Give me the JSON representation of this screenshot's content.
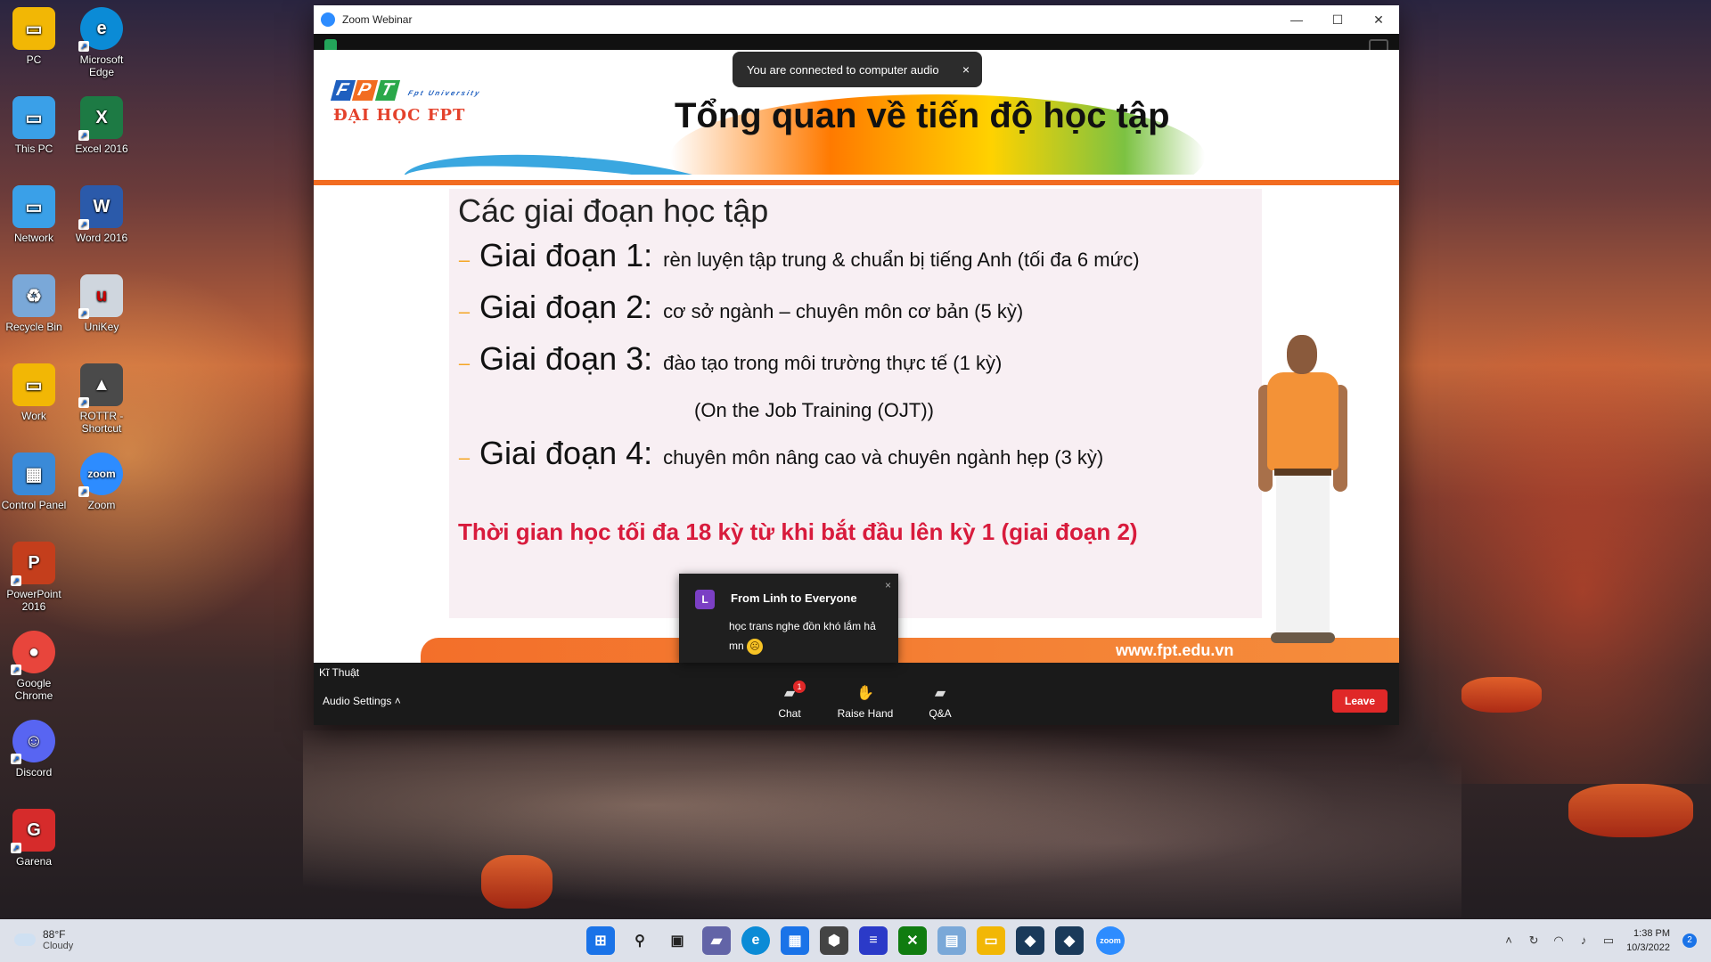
{
  "desktop": {
    "icons": [
      {
        "label": "PC",
        "color": "#f2b705"
      },
      {
        "label": "Microsoft Edge",
        "color": "#0b8bd6"
      },
      {
        "label": "This PC",
        "color": "#3aa0e8"
      },
      {
        "label": "Excel 2016",
        "color": "#1d7a44"
      },
      {
        "label": "Network",
        "color": "#3aa0e8"
      },
      {
        "label": "Word 2016",
        "color": "#2b5aaa"
      },
      {
        "label": "Recycle Bin",
        "color": "#7aa8d8"
      },
      {
        "label": "UniKey",
        "color": "#cfd6de"
      },
      {
        "label": "Work",
        "color": "#f2b705"
      },
      {
        "label": "ROTTR - Shortcut",
        "color": "#4a4a4a"
      },
      {
        "label": "Control Panel",
        "color": "#3a8ad8"
      },
      {
        "label": "Zoom",
        "color": "#2d8cff"
      },
      {
        "label": "PowerPoint 2016",
        "color": "#c43e1c"
      },
      {
        "label": "Google Chrome",
        "color": "#e8453c"
      },
      {
        "label": "Discord",
        "color": "#5865f2"
      },
      {
        "label": "Garena",
        "color": "#d62b2b"
      }
    ]
  },
  "window": {
    "title": "Zoom Webinar",
    "minimize_glyph": "—",
    "maximize_glyph": "☐",
    "close_glyph": "✕"
  },
  "toast": {
    "text": "You are connected to computer audio",
    "close": "×"
  },
  "slide": {
    "logo_fpt": [
      "F",
      "P",
      "T"
    ],
    "logo_university": "Fpt University",
    "logo_school": "ĐẠI HỌC FPT",
    "title": "Tổng quan về tiến độ học tập",
    "heading": "Các giai đoạn học tập",
    "stages": [
      {
        "name": "Giai đoạn 1:",
        "desc": "rèn luyện tập trung & chuẩn bị tiếng Anh (tối đa 6 mức)"
      },
      {
        "name": "Giai đoạn 2:",
        "desc": "cơ sở ngành – chuyên môn cơ bản (5 kỳ)"
      },
      {
        "name": "Giai đoạn 3:",
        "desc": "đào tạo trong môi trường thực tế (1 kỳ)",
        "sub": "(On the Job Training (OJT))"
      },
      {
        "name": "Giai đoạn 4:",
        "desc": "chuyên môn nâng cao và chuyên ngành hẹp (3 kỳ)"
      }
    ],
    "note": "Thời gian học tối đa 18 kỳ từ khi bắt đầu lên kỳ 1 (giai đoạn 2)",
    "website": "www.fpt.edu.vn"
  },
  "chat_popup": {
    "avatar_letter": "L",
    "from": "From Linh to Everyone",
    "message": "học trans nghe đồn khó lắm hả mn",
    "emoji": "☹",
    "close": "×"
  },
  "participant_name": "Kĩ Thuật",
  "toolbar": {
    "audio_settings": "Audio Settings",
    "chat": "Chat",
    "chat_badge": "1",
    "raise_hand": "Raise Hand",
    "qa": "Q&A",
    "leave": "Leave"
  },
  "taskbar": {
    "weather_temp": "88°F",
    "weather_cond": "Cloudy",
    "time": "1:38 PM",
    "date": "10/3/2022",
    "notifications": "2"
  }
}
